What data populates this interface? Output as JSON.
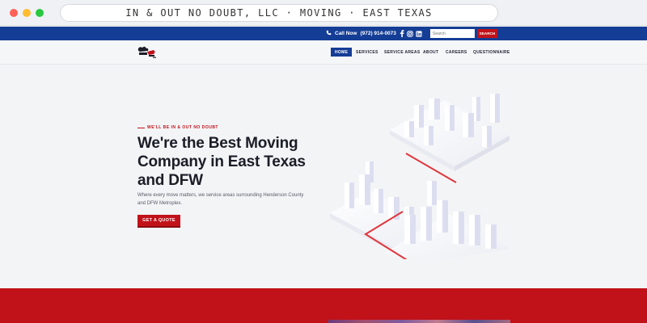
{
  "browser": {
    "url_text": "IN & OUT NO DOUBT, LLC · MOVING · EAST TEXAS"
  },
  "topbar": {
    "call_label": "Call Now",
    "phone": "(972) 914-0073",
    "social_icons": [
      "facebook-icon",
      "instagram-icon",
      "linkedin-icon"
    ],
    "search_placeholder": "Search",
    "search_button": "SEARCH"
  },
  "nav": {
    "items": [
      {
        "label": "HOME",
        "active": true
      },
      {
        "label": "SERVICES",
        "active": false
      },
      {
        "label": "SERVICE AREAS",
        "active": false
      },
      {
        "label": "ABOUT",
        "active": false
      },
      {
        "label": "CAREERS",
        "active": false
      },
      {
        "label": "QUESTIONNAIRE",
        "active": false
      }
    ]
  },
  "hero": {
    "eyebrow": "WE'LL BE IN & OUT NO DOUBT",
    "headline": "We're the Best Moving Company in East Texas and DFW",
    "subtext": "Where every move matters, we service areas surrounding Henderson County and DFW Metroplex.",
    "cta": "GET A QUOTE"
  },
  "colors": {
    "brand_blue": "#143d95",
    "brand_red": "#c1121a",
    "background": "#f3f4f6",
    "text_dark": "#1a1d26"
  }
}
